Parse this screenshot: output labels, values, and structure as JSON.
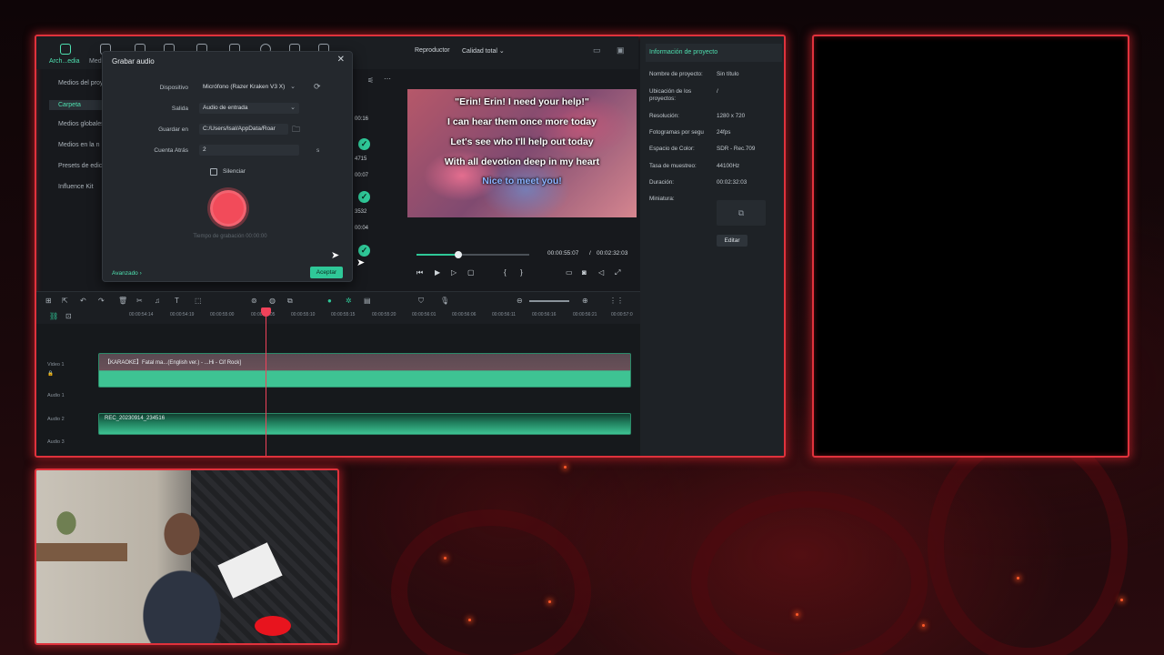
{
  "colors": {
    "accent": "#2fc898",
    "frame": "#e0323c",
    "record": "#f24b5a"
  },
  "top_tabs": [
    {
      "label": "Arch...edia",
      "icon": "media-icon"
    },
    {
      "label": "Med",
      "icon": "chat-icon"
    }
  ],
  "left_panel": {
    "items": [
      "Medios del proy",
      "Carpeta",
      "Medios globales",
      "Medios en la n",
      "Presets de edic",
      "Influence Kit"
    ]
  },
  "media_column": {
    "numbers": [
      "00:16",
      "4715",
      "00:07",
      "3532",
      "00:04"
    ]
  },
  "dialog": {
    "title": "Grabar audio",
    "device_label": "Dispositivo",
    "device_value": "Micrófono (Razer Kraken V3 X)",
    "output_label": "Salida",
    "output_value": "Audio de entrada",
    "save_label": "Guardar en",
    "save_value": "C:/Users/lsal/AppData/Roar",
    "countdown_label": "Cuenta Atrás",
    "countdown_value": "2",
    "countdown_unit": "s",
    "mute_label": "Silenciar",
    "rec_time": "Tiempo de grabación 00:00:00",
    "advanced": "Avanzado",
    "accept": "Aceptar"
  },
  "player": {
    "label": "Reproductor",
    "quality": "Calidad total",
    "lyrics": [
      "\"Erin! Erin! I need your help!\"",
      "I can hear them once more today",
      "Let's see who I'll help out today",
      "With all devotion deep in my heart",
      "Nice to meet you!"
    ],
    "current_time": "00:00:55:07",
    "separator": "/",
    "total_time": "00:02:32:03",
    "progress": 0.37
  },
  "project_info": {
    "tab": "Información de proyecto",
    "rows": [
      {
        "label": "Nombre de proyecto:",
        "value": "Sin título"
      },
      {
        "label": "Ubicación de los proyectos:",
        "value": "/"
      },
      {
        "label": "Resolución:",
        "value": "1280 x 720"
      },
      {
        "label": "Fotogramas por segu",
        "value": "24fps"
      },
      {
        "label": "Espacio de Color:",
        "value": "SDR - Rec.709"
      },
      {
        "label": "Tasa de muestreo:",
        "value": "44100Hz"
      },
      {
        "label": "Duración:",
        "value": "00:02:32:03"
      },
      {
        "label": "Miniatura:",
        "value": ""
      }
    ],
    "edit": "Editar"
  },
  "ruler": {
    "ticks": [
      "00:00:54:14",
      "00:00:54:19",
      "00:00:55:00",
      "00:00:55:05",
      "00:00:55:10",
      "00:00:55:15",
      "00:00:55:20",
      "00:00:56:01",
      "00:00:56:06",
      "00:00:56:11",
      "00:00:56:16",
      "00:00:56:21",
      "00:00:57:0"
    ]
  },
  "tracks": {
    "video1": "Video 1",
    "audio1": "Audio 1",
    "audio2": "Audio 2",
    "audio3": "Audio 3",
    "video_clip": "【KARAOKE】Fatal ma...(English ver.) - ...Hi - Cif Rock]",
    "audio_clip": "REC_20230914_234516"
  }
}
